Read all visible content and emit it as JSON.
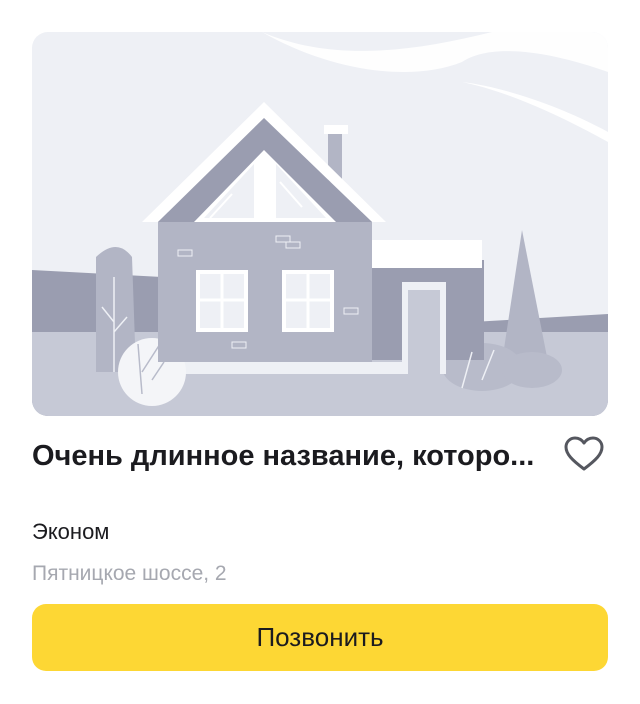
{
  "listing": {
    "title": "Очень длинное название, которо...",
    "category": "Эконом",
    "address": "Пятницкое шоссе, 2",
    "call_label": "Позвонить"
  },
  "icons": {
    "favorite": "heart-outline-icon",
    "image": "house-illustration"
  },
  "colors": {
    "accent": "#fdd734",
    "text_primary": "#1b1b1f",
    "text_secondary": "#a6a8b0"
  }
}
